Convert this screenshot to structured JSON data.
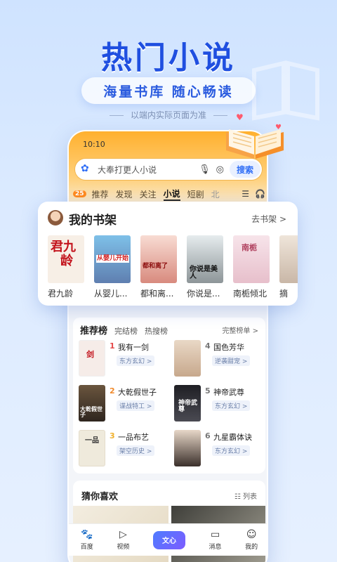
{
  "hero": {
    "headline": "热门小说",
    "tagline": "海量书库  随心畅读",
    "disclaimer": "以端内实际页面为准"
  },
  "status_bar": {
    "time": "10:10"
  },
  "search": {
    "placeholder": "大奉打更人小说",
    "button_label": "搜索"
  },
  "nav_tabs": {
    "badge": "25",
    "items": [
      "推荐",
      "发现",
      "关注",
      "小说",
      "短剧",
      "北"
    ],
    "active": "小说",
    "more_icon": "menu-icon",
    "headphone_icon": "headphone-icon"
  },
  "bookshelf": {
    "title": "我的书架",
    "link": "去书架 >",
    "books": [
      {
        "name": "君九龄",
        "cover_text": "君九龄",
        "cover_color": "#f7efe6"
      },
      {
        "name": "从婴儿...",
        "cover_text": "从婴儿开始 逆袭人生",
        "cover_color": "#7ec0e8"
      },
      {
        "name": "都和离...",
        "cover_text": "都和离了谁还惯着你",
        "cover_color": "#f3c9c2"
      },
      {
        "name": "你说是...",
        "cover_text": "你说是美人",
        "cover_color": "#cfd6d8"
      },
      {
        "name": "南栀倾北",
        "cover_text": "南栀倾北",
        "cover_color": "#f2d6de"
      },
      {
        "name": "摘",
        "cover_text": "",
        "cover_color": "#e8dcd0"
      }
    ]
  },
  "ranking": {
    "tabs": [
      "推荐榜",
      "完结榜",
      "热搜榜"
    ],
    "more": "完整榜单 >",
    "items": [
      {
        "no": "1",
        "title": "我有一剑",
        "tag": "东方玄幻 >",
        "no_color": "#e54848",
        "cover": "#f6ece8"
      },
      {
        "no": "2",
        "title": "大乾假世子",
        "tag": "谍战特工 >",
        "no_color": "#f08a2c",
        "cover": "#4a3a2e"
      },
      {
        "no": "3",
        "title": "一品布艺",
        "tag": "架空历史 >",
        "no_color": "#f0b02c",
        "cover": "#efeadc"
      },
      {
        "no": "4",
        "title": "国色芳华",
        "tag": "逆袭甜宠 >",
        "no_color": "#777777",
        "cover": "#e2d2c2"
      },
      {
        "no": "5",
        "title": "神帝武尊",
        "tag": "东方玄幻 >",
        "no_color": "#777777",
        "cover": "#2f2f33"
      },
      {
        "no": "6",
        "title": "九星霸体诀",
        "tag": "东方玄幻 >",
        "no_color": "#777777",
        "cover": "#514842"
      }
    ]
  },
  "guess": {
    "title": "猜你喜欢",
    "list_label": "列表"
  },
  "bottom_nav": {
    "items": [
      {
        "label": "百度",
        "icon": "paw-icon"
      },
      {
        "label": "视频",
        "icon": "video-icon"
      },
      {
        "label": "文心",
        "icon": "wenxin-icon"
      },
      {
        "label": "消息",
        "icon": "message-icon"
      },
      {
        "label": "我的",
        "icon": "profile-icon"
      }
    ]
  },
  "colors": {
    "brand_blue": "#1f4fe0",
    "tab_orange": "#ffb02e"
  }
}
